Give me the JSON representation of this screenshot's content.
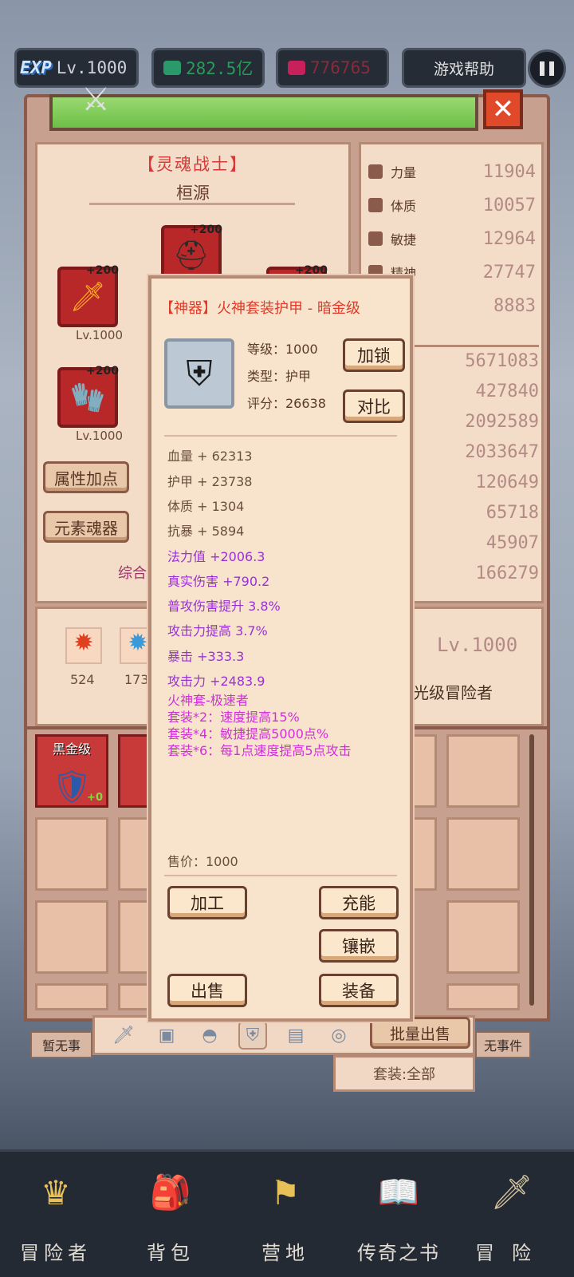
{
  "topbar": {
    "exp_tag": "EXP",
    "level": "Lv.1000",
    "gold": "282.5亿",
    "gems": "776765",
    "help": "游戏帮助"
  },
  "character": {
    "class_title": "【灵魂战士】",
    "name": "桓源",
    "slots": [
      {
        "plus": "+200",
        "level": "Lv.1000"
      },
      {
        "plus": "+200",
        "level": ""
      },
      {
        "plus": "+200",
        "level": "Lv.1000"
      },
      {
        "plus": "+200",
        "level": ""
      }
    ],
    "buttons": {
      "add_points": "属性加点",
      "element_soul": "元素魂器"
    },
    "score_partial": "综合"
  },
  "stats": [
    {
      "name": "力量",
      "value": "11904"
    },
    {
      "name": "体质",
      "value": "10057"
    },
    {
      "name": "敏捷",
      "value": "12964"
    },
    {
      "name": "精神",
      "value": "27747"
    },
    {
      "name": "力",
      "value": "8883"
    }
  ],
  "combat_values": [
    "5671083",
    "427840",
    "2092589",
    "2033647",
    "120649",
    "65718",
    "45907",
    "166279"
  ],
  "lower": {
    "items": [
      {
        "count": "524"
      },
      {
        "count": "173"
      }
    ],
    "level": "Lv.1000",
    "rank_partial": "光级冒险者"
  },
  "inventory": {
    "items": [
      {
        "label": "黑金级",
        "plus": "+0"
      },
      {
        "label": "黑"
      }
    ],
    "batch_sell": "批量出售",
    "suit_filter": "套装:全部",
    "left_tag": "暂无事",
    "right_tag": "无事件"
  },
  "popup": {
    "title": "【神器】火神套装护甲 - 暗金级",
    "level_label": "等级：1000",
    "type_label": "类型：护甲",
    "score_label": "评分：26638",
    "lock_btn": "加锁",
    "compare_btn": "对比",
    "base_attrs": [
      "血量 + 62313",
      "护甲 + 23738",
      "体质 + 1304",
      "抗暴 + 5894"
    ],
    "extra_attrs": [
      "法力值 +2006.3",
      "真实伤害 +790.2",
      "普攻伤害提升 3.8%",
      "攻击力提高 3.7%",
      "暴击 +333.3",
      "攻击力 +2483.9"
    ],
    "set_name": "火神套-极速者",
    "set_bonuses": [
      "套装*2：速度提高15%",
      "套装*4：敏捷提高5000点%",
      "套装*6：每1点速度提高5点攻击"
    ],
    "price": "售价：1000",
    "actions": {
      "process": "加工",
      "charge": "充能",
      "inlay": "镶嵌",
      "sell": "出售",
      "equip": "装备"
    }
  },
  "nav": [
    {
      "label": "冒险者",
      "icon": "helmet-icon"
    },
    {
      "label": "背包",
      "icon": "backpack-icon"
    },
    {
      "label": "营地",
      "icon": "camp-banner-icon"
    },
    {
      "label": "传奇之书",
      "icon": "book-icon"
    },
    {
      "label": "冒险",
      "icon": "sword-icon"
    }
  ]
}
